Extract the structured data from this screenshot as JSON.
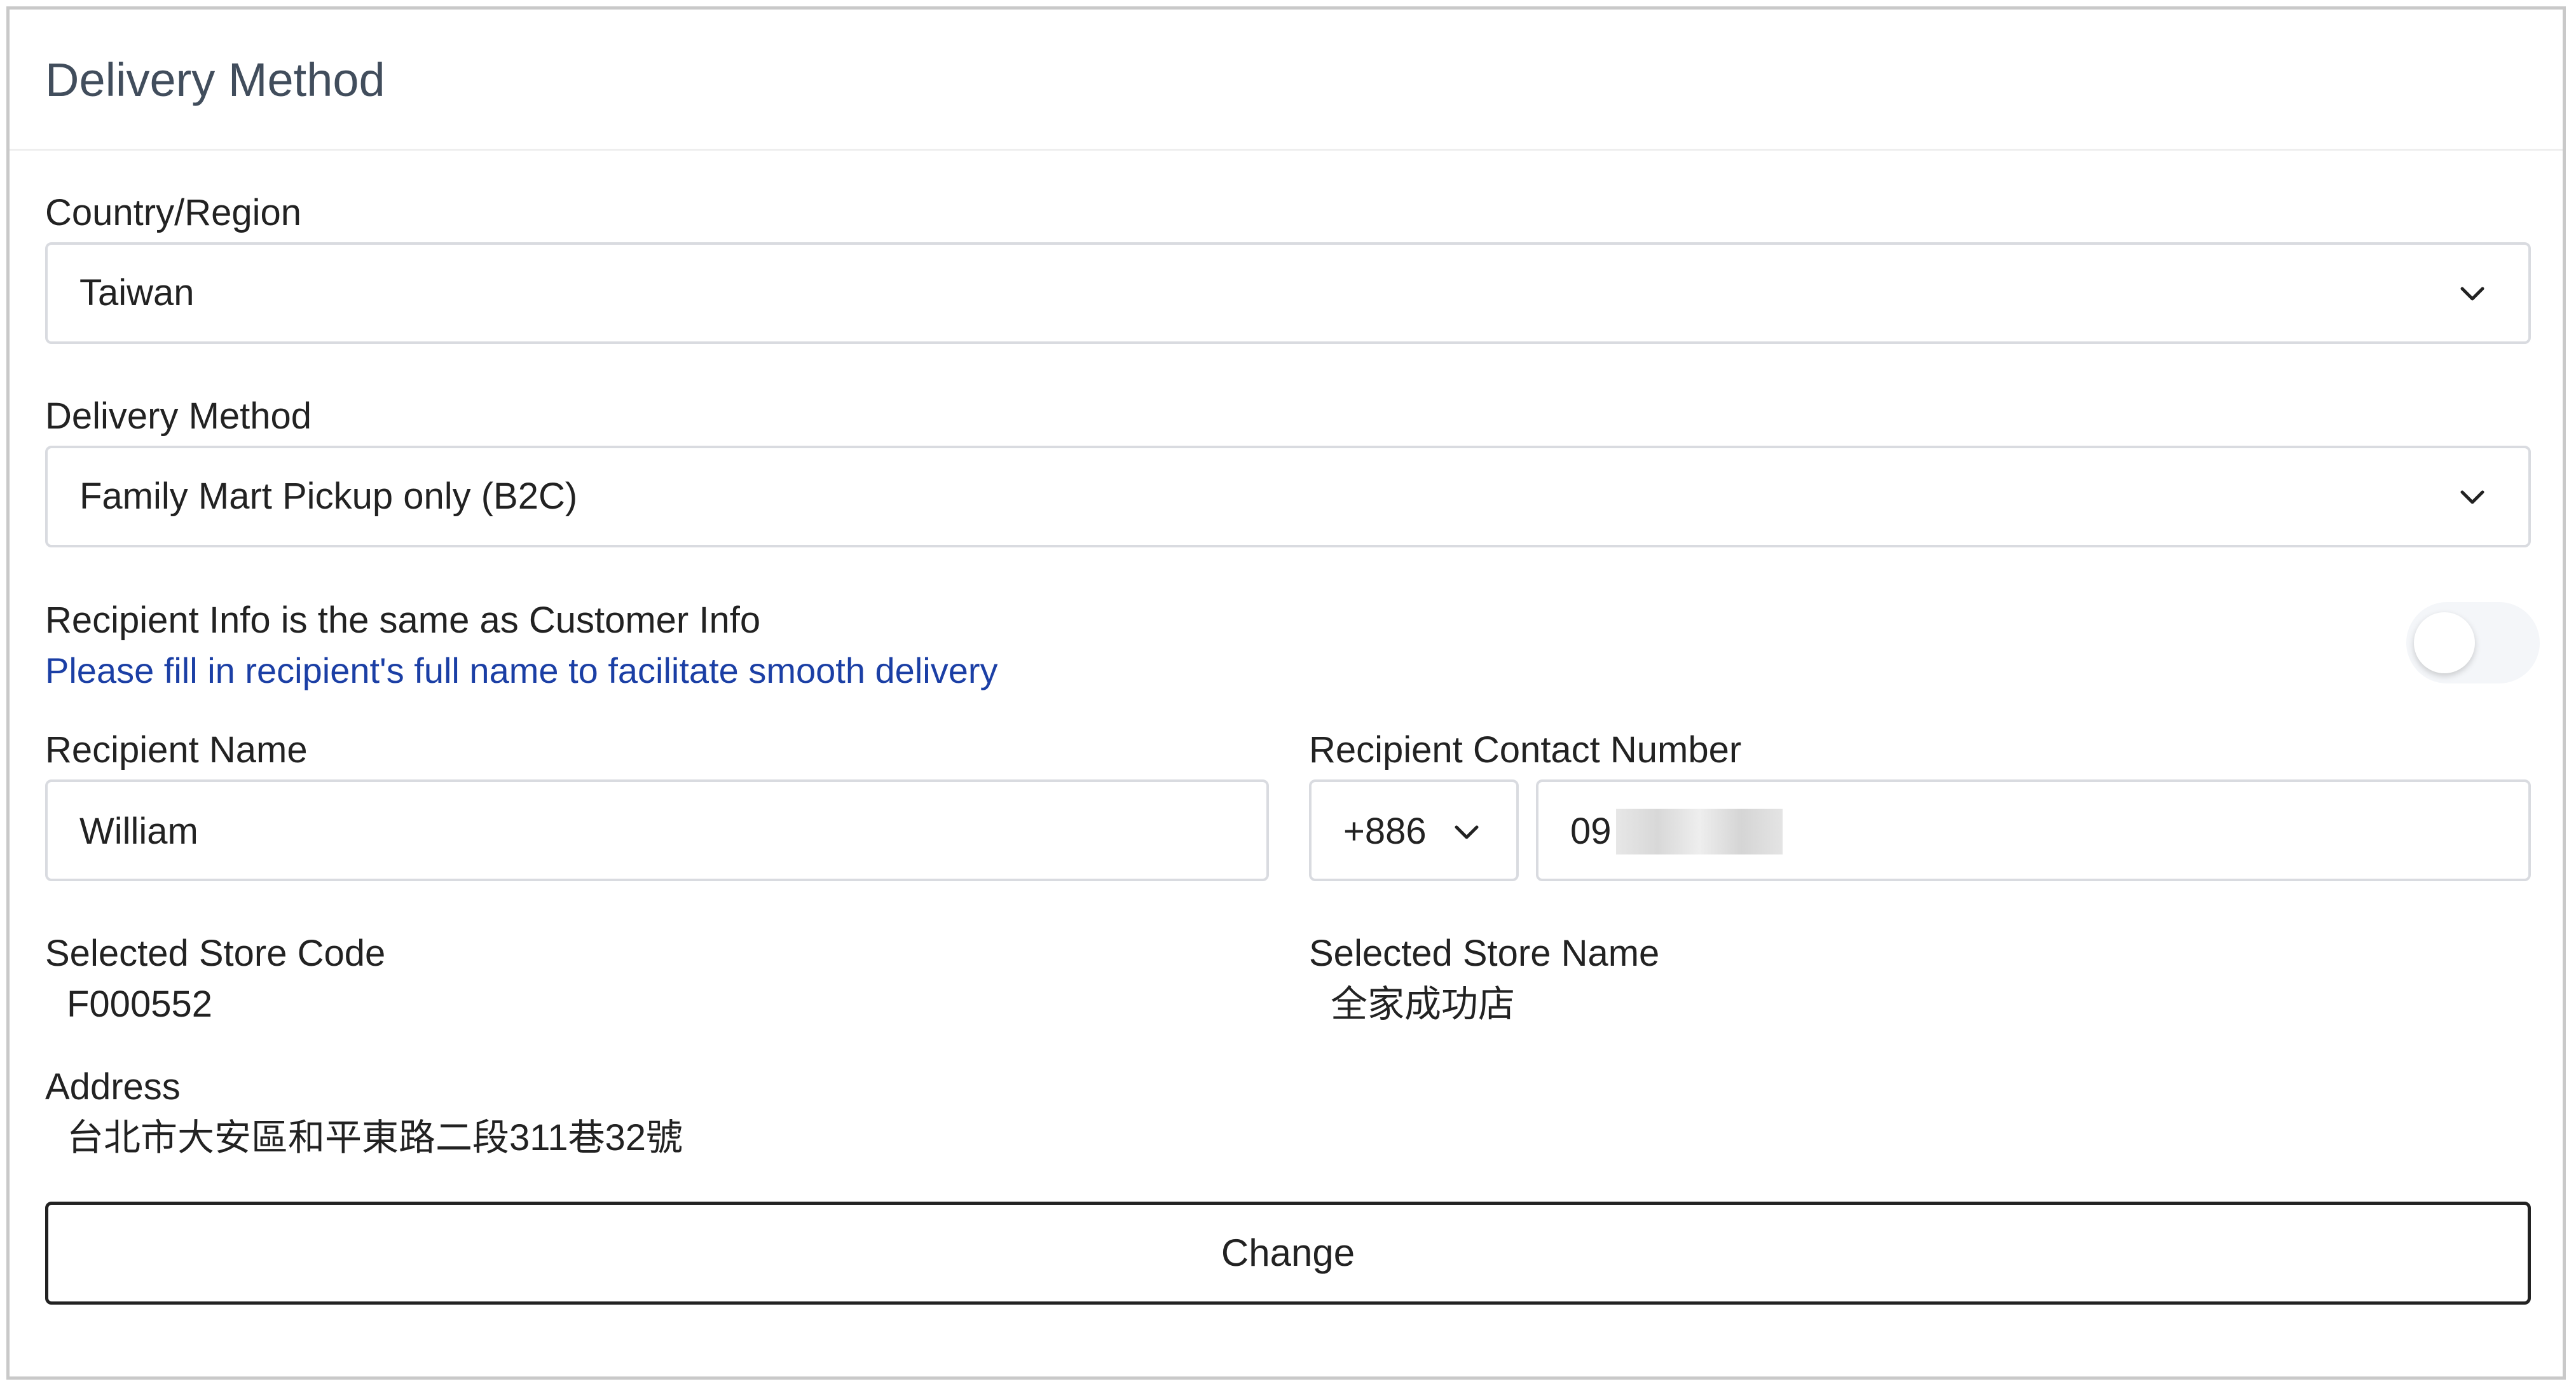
{
  "panel": {
    "title": "Delivery Method"
  },
  "country": {
    "label": "Country/Region",
    "value": "Taiwan"
  },
  "delivery": {
    "label": "Delivery Method",
    "value": "Family Mart Pickup only (B2C)"
  },
  "recipient_same": {
    "label": "Recipient Info is the same as Customer Info",
    "hint": "Please fill in recipient's full name to facilitate smooth delivery",
    "toggle_on": false
  },
  "recipient_name": {
    "label": "Recipient Name",
    "value": "William"
  },
  "recipient_contact": {
    "label": "Recipient Contact Number",
    "country_code": "+886",
    "number_visible": "09"
  },
  "store_code": {
    "label": "Selected Store Code",
    "value": "F000552"
  },
  "store_name": {
    "label": "Selected Store Name",
    "value": "全家成功店"
  },
  "address": {
    "label": "Address",
    "value": "台北市大安區和平東路二段311巷32號"
  },
  "buttons": {
    "change_label": "Change"
  },
  "icons": {
    "dropdown": "chevron-down-icon"
  },
  "colors": {
    "hint_text": "#1b3fa5",
    "title_text": "#414d5c",
    "border": "#d9dbe0"
  }
}
